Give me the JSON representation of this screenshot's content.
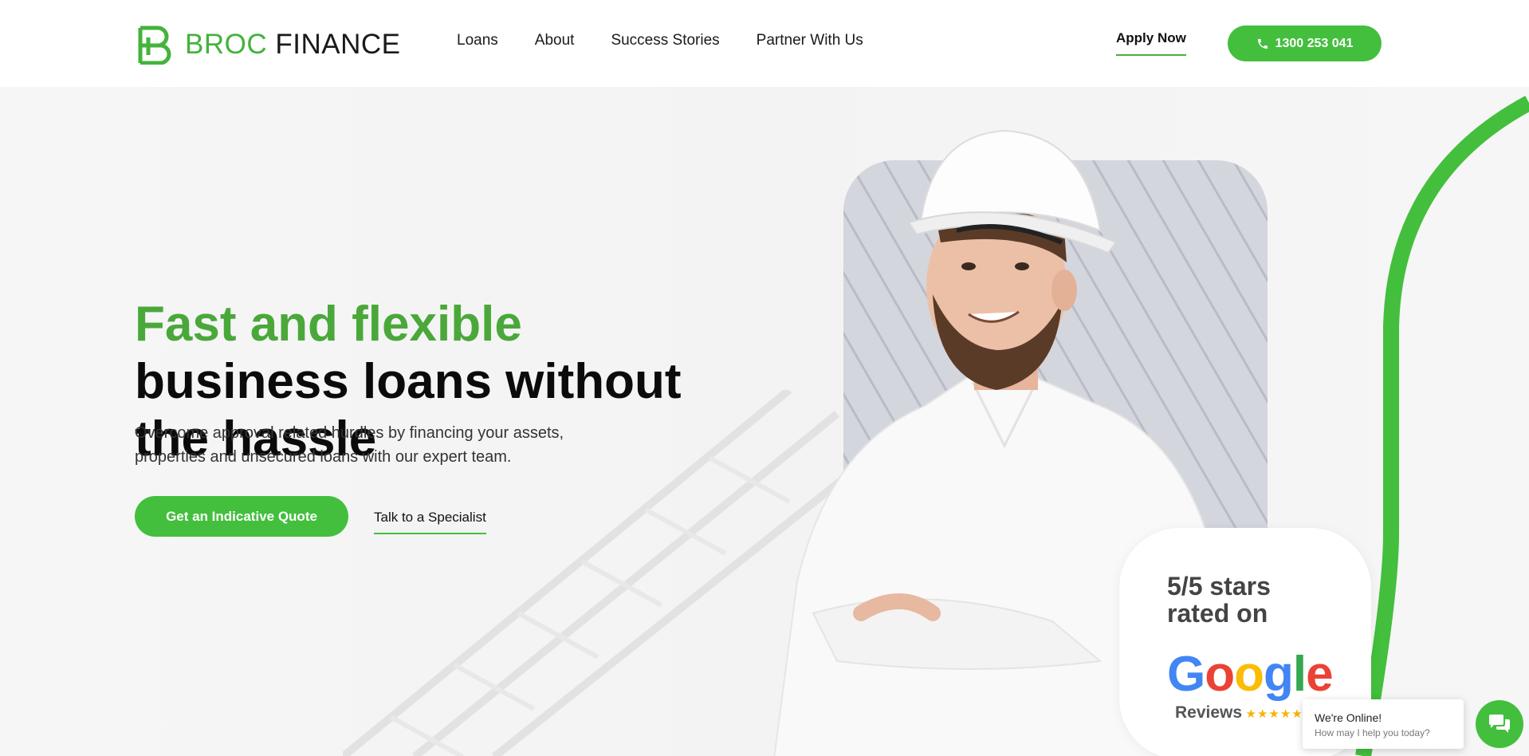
{
  "header": {
    "logo": {
      "part1": "BROC",
      "part2": "FINANCE",
      "mark_icon": "broc-b-monogram-icon"
    },
    "nav": [
      "Loans",
      "About",
      "Success Stories",
      "Partner With Us"
    ],
    "apply_label": "Apply Now",
    "phone_label": "1300 253 041",
    "phone_icon": "phone-icon"
  },
  "hero": {
    "headline_green": "Fast and flexible",
    "headline_dark": " business loans without the hassle",
    "subtext": "Overcome approval related hurdles by financing your assets, properties and unsecured loans with our expert team.",
    "quote_button": "Get an Indicative Quote",
    "specialist_link": "Talk to a Specialist"
  },
  "review": {
    "line1": "5/5 stars",
    "line2": "rated on",
    "brand": "Google",
    "label": "Reviews",
    "stars": "★★★★★",
    "rating": 5,
    "max_rating": 5
  },
  "chat": {
    "title": "We're Online!",
    "subtitle": "How may I help you today?",
    "icon": "chat-bubbles-icon"
  },
  "colors": {
    "brand_green": "#43bf3d",
    "headline_green": "#4aa83a",
    "text_dark": "#0b0b0b",
    "star_yellow": "#f6b400",
    "google_blue": "#4285F4",
    "google_red": "#EA4335",
    "google_yellow": "#FBBC05",
    "google_green": "#34A853"
  }
}
